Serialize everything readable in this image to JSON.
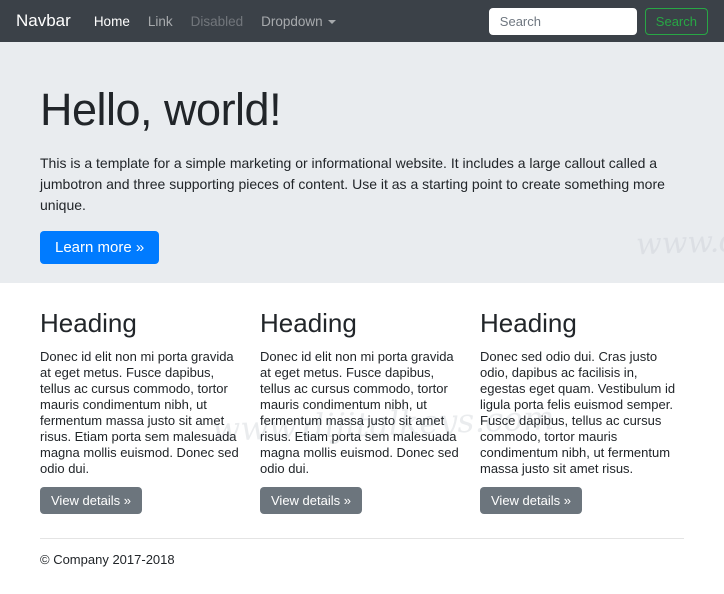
{
  "navbar": {
    "brand": "Navbar",
    "items": [
      {
        "label": "Home",
        "state": "active"
      },
      {
        "label": "Link",
        "state": "normal"
      },
      {
        "label": "Disabled",
        "state": "disabled"
      },
      {
        "label": "Dropdown",
        "state": "dropdown-toggle"
      }
    ],
    "search": {
      "placeholder": "Search",
      "button_label": "Search"
    }
  },
  "jumbotron": {
    "title": "Hello, world!",
    "lead": "This is a template for a simple marketing or informational website. It includes a large callout called a jumbotron and three supporting pieces of content. Use it as a starting point to create something more unique.",
    "button_label": "Learn more »"
  },
  "columns": [
    {
      "heading": "Heading",
      "text": "Donec id elit non mi porta gravida at eget metus. Fusce dapibus, tellus ac cursus commodo, tortor mauris condimentum nibh, ut fermentum massa justo sit amet risus. Etiam porta sem malesuada magna mollis euismod. Donec sed odio dui.",
      "button_label": "View details »"
    },
    {
      "heading": "Heading",
      "text": "Donec id elit non mi porta gravida at eget metus. Fusce dapibus, tellus ac cursus commodo, tortor mauris condimentum nibh, ut fermentum massa justo sit amet risus. Etiam porta sem malesuada magna mollis euismod. Donec sed odio dui.",
      "button_label": "View details »"
    },
    {
      "heading": "Heading",
      "text": "Donec sed odio dui. Cras justo odio, dapibus ac facilisis in, egestas eget quam. Vestibulum id ligula porta felis euismod semper. Fusce dapibus, tellus ac cursus commodo, tortor mauris condimentum nibh, ut fermentum massa justo sit amet risus.",
      "button_label": "View details »"
    }
  ],
  "footer": {
    "copyright": "© Company 2017-2018"
  },
  "watermark": {
    "text": "www.dijitalkeys.com"
  },
  "colors": {
    "navbar_bg": "#3b4148",
    "jumbotron_bg": "#e9ecef",
    "primary": "#007bff",
    "secondary": "#6c757d",
    "success_outline": "#28a745"
  }
}
